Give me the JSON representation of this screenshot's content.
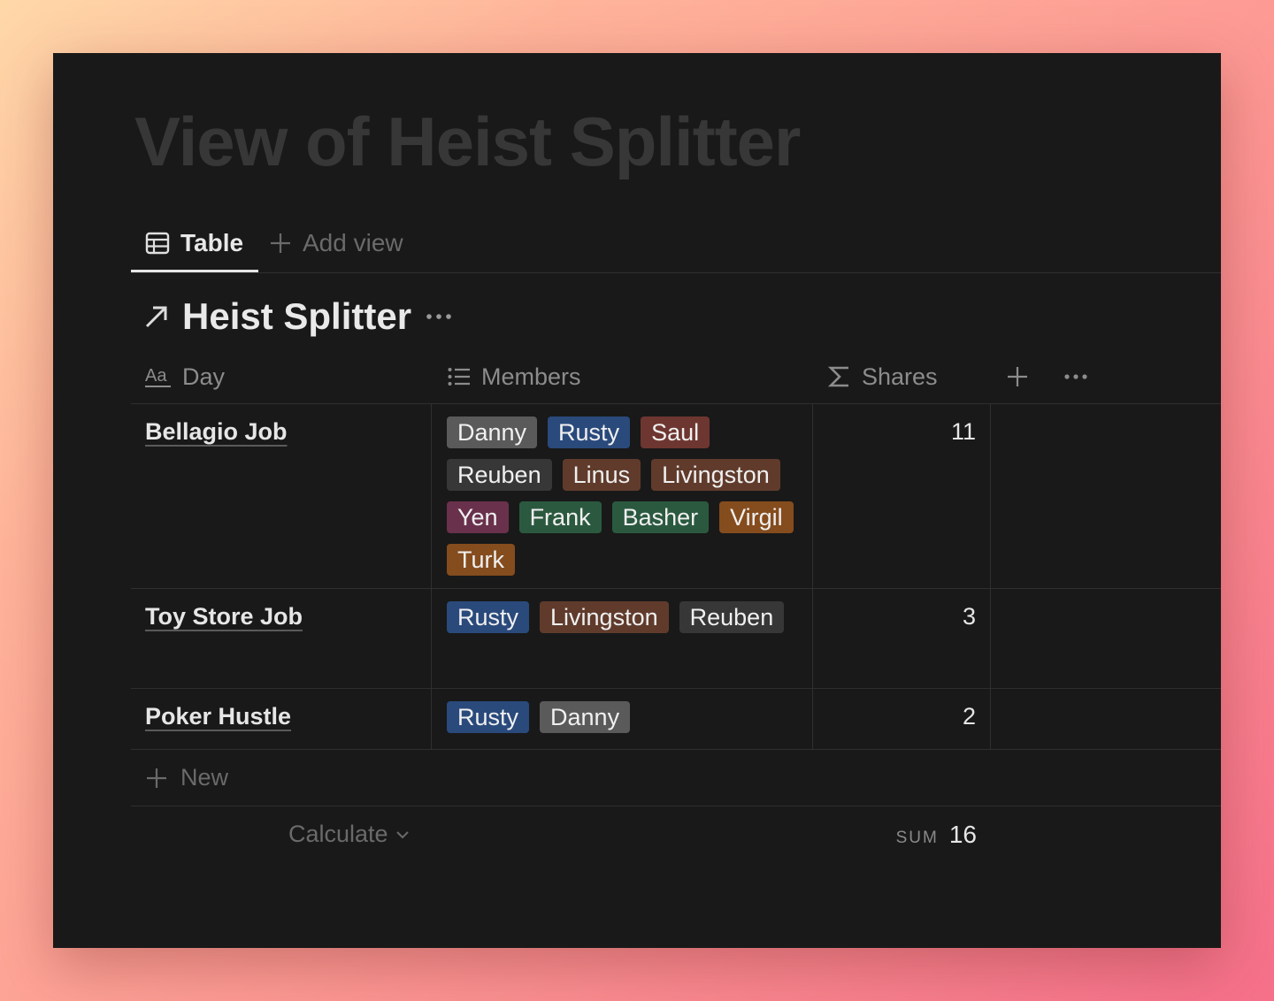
{
  "page": {
    "title": "View of Heist Splitter"
  },
  "tabs": {
    "active": "Table",
    "add": "Add view"
  },
  "database": {
    "title": "Heist Splitter"
  },
  "columns": {
    "day": "Day",
    "members": "Members",
    "shares": "Shares"
  },
  "icons": {
    "table": "table-grid-icon",
    "add": "plus-icon",
    "link": "arrow-up-right-icon",
    "more": "more-horizontal-icon",
    "title_prop": "text-aa-icon",
    "multiselect_prop": "list-icon",
    "formula_prop": "sigma-icon",
    "chevron": "chevron-down-icon"
  },
  "tag_colors": {
    "gray": "#5a5a5a",
    "dark": "#373737",
    "blue": "#2a4a7c",
    "red": "#6e3630",
    "brown": "#603b2c",
    "pink": "#69314c",
    "green": "#2b593f",
    "orange": "#854c1d"
  },
  "rows": [
    {
      "day": "Bellagio Job",
      "members": [
        {
          "name": "Danny",
          "color": "gray"
        },
        {
          "name": "Rusty",
          "color": "blue"
        },
        {
          "name": "Saul",
          "color": "red"
        },
        {
          "name": "Reuben",
          "color": "dark"
        },
        {
          "name": "Linus",
          "color": "brown"
        },
        {
          "name": "Livingston",
          "color": "brown"
        },
        {
          "name": "Yen",
          "color": "pink"
        },
        {
          "name": "Frank",
          "color": "green"
        },
        {
          "name": "Basher",
          "color": "green"
        },
        {
          "name": "Virgil",
          "color": "orange"
        },
        {
          "name": "Turk",
          "color": "orange"
        }
      ],
      "shares": "11"
    },
    {
      "day": "Toy Store Job",
      "members": [
        {
          "name": "Rusty",
          "color": "blue"
        },
        {
          "name": "Livingston",
          "color": "brown"
        },
        {
          "name": "Reuben",
          "color": "dark"
        }
      ],
      "shares": "3"
    },
    {
      "day": "Poker Hustle",
      "members": [
        {
          "name": "Rusty",
          "color": "blue"
        },
        {
          "name": "Danny",
          "color": "gray"
        }
      ],
      "shares": "2"
    }
  ],
  "new_row": "New",
  "footer": {
    "calculate": "Calculate",
    "sum_label": "SUM",
    "sum_value": "16"
  }
}
